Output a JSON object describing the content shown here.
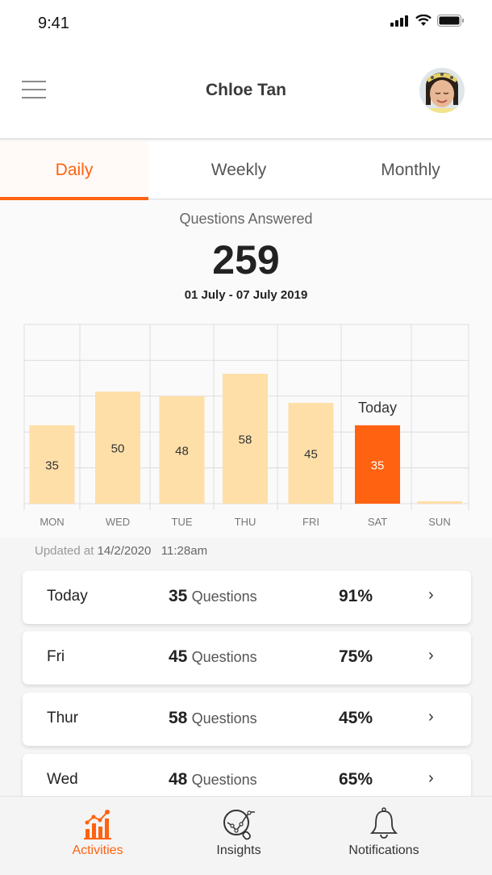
{
  "status_bar": {
    "time": "9:41"
  },
  "header": {
    "title": "Chloe Tan",
    "menu_icon": "hamburger-menu-icon",
    "avatar": "user-avatar-photo"
  },
  "tabs": [
    {
      "label": "Daily",
      "active": true
    },
    {
      "label": "Weekly",
      "active": false
    },
    {
      "label": "Monthly",
      "active": false
    }
  ],
  "summary": {
    "label": "Questions Answered",
    "total": "259",
    "date_range": "01 July - 07 July 2019"
  },
  "colors": {
    "accent": "#ff6210",
    "bar": "#ffdfa8",
    "grid": "#dddddd"
  },
  "chart_data": {
    "type": "bar",
    "categories": [
      "MON",
      "WED",
      "TUE",
      "THU",
      "FRI",
      "SAT",
      "SUN"
    ],
    "values": [
      35,
      50,
      48,
      58,
      45,
      35,
      0
    ],
    "value_labels": [
      "35",
      "50",
      "48",
      "58",
      "45",
      "35",
      ""
    ],
    "highlight_index": 5,
    "highlight_annotation": "Today",
    "ylim": [
      0,
      80
    ],
    "grid": true,
    "title": "",
    "xlabel": "",
    "ylabel": ""
  },
  "updated": {
    "prefix": "Updated at",
    "date": "14/2/2020",
    "time": "11:28am"
  },
  "records": [
    {
      "day": "Today",
      "count": "35",
      "unit": "Questions",
      "percent": "91%",
      "chevron": "›"
    },
    {
      "day": "Fri",
      "count": "45",
      "unit": "Questions",
      "percent": "75%",
      "chevron": "›"
    },
    {
      "day": "Thur",
      "count": "58",
      "unit": "Questions",
      "percent": "45%",
      "chevron": "›"
    },
    {
      "day": "Wed",
      "count": "48",
      "unit": "Questions",
      "percent": "65%",
      "chevron": "›"
    }
  ],
  "bottom_nav": [
    {
      "label": "Activities",
      "icon": "activities-chart-icon",
      "active": true
    },
    {
      "label": "Insights",
      "icon": "insights-magnifier-icon",
      "active": false
    },
    {
      "label": "Notifications",
      "icon": "bell-icon",
      "active": false
    }
  ]
}
